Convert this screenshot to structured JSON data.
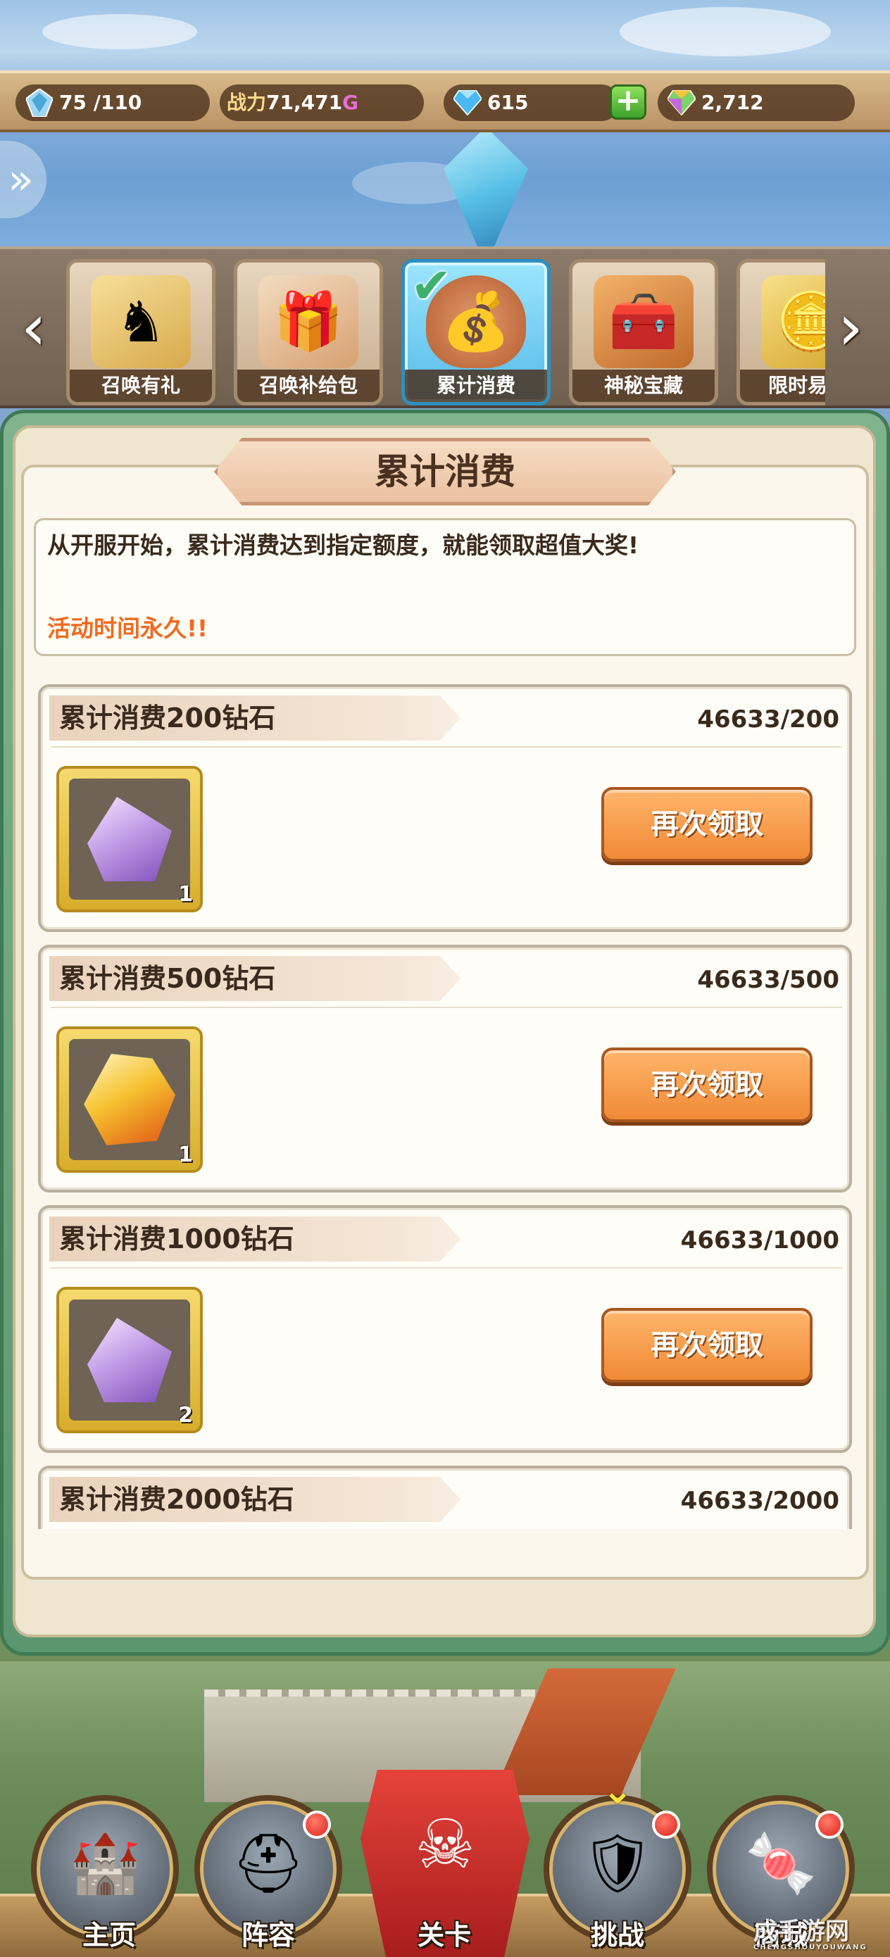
{
  "resources": {
    "stamina": "75 /110",
    "power_label": "战力",
    "power_value": "71,471",
    "power_suffix": "G",
    "diamonds": "615",
    "gems": "2,712"
  },
  "tabs": [
    {
      "label": "召唤有礼",
      "icon": "horse-icon"
    },
    {
      "label": "召唤补给包",
      "icon": "treasure-icon"
    },
    {
      "label": "累计消费",
      "icon": "money-bag-icon",
      "active": true
    },
    {
      "label": "神秘宝藏",
      "icon": "chest-icon"
    },
    {
      "label": "限时易",
      "icon": "coins-icon"
    }
  ],
  "panel": {
    "title": "累计消费",
    "description": "从开服开始，累计消费达到指定额度，就能领取超值大奖!",
    "time_note": "活动时间永久!!"
  },
  "rewards": [
    {
      "title": "累计消费200钻石",
      "progress": "46633/200",
      "item": "purple-crystal-icon",
      "count": "1",
      "button": "再次领取"
    },
    {
      "title": "累计消费500钻石",
      "progress": "46633/500",
      "item": "gold-gem-icon",
      "count": "1",
      "button": "再次领取"
    },
    {
      "title": "累计消费1000钻石",
      "progress": "46633/1000",
      "item": "purple-crystal-icon",
      "count": "2",
      "button": "再次领取"
    },
    {
      "title": "累计消费2000钻石",
      "progress": "46633/2000"
    }
  ],
  "nav": [
    {
      "label": "主页",
      "icon": "castle-icon"
    },
    {
      "label": "阵容",
      "icon": "helmet-icon"
    },
    {
      "label": "关卡",
      "icon": "skull-banner-icon"
    },
    {
      "label": "挑战",
      "icon": "shield-swords-icon"
    },
    {
      "label": "商城",
      "icon": "gumball-machine-icon"
    }
  ],
  "watermark": {
    "text": "成手游网",
    "sub": "CHENGSHOUYOUWANG"
  }
}
